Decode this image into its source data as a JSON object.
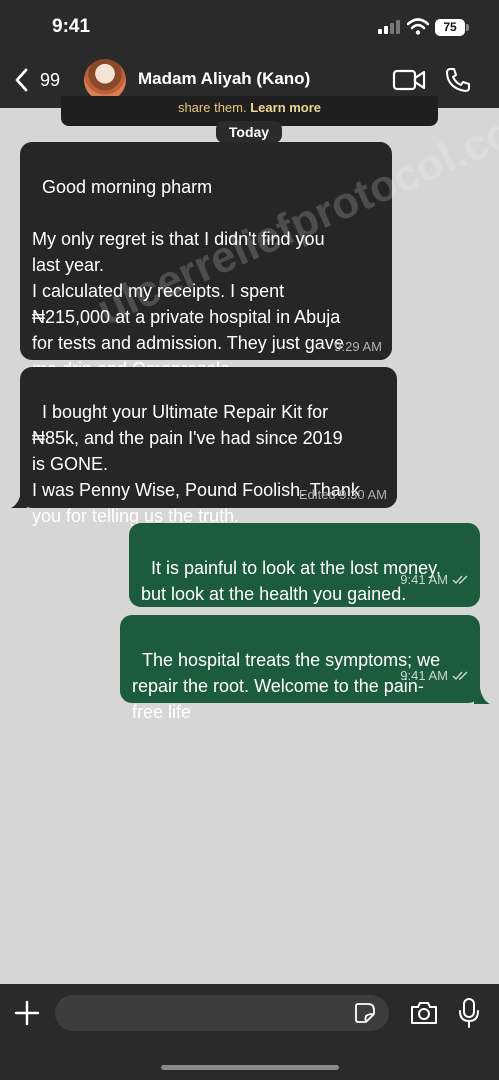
{
  "status_bar": {
    "time": "9:41",
    "battery": "75"
  },
  "header": {
    "back_count": "99",
    "contact_name": "Madam Aliyah (Kano)"
  },
  "banner": {
    "text": "share them.",
    "link": "Learn more"
  },
  "date_divider": "Today",
  "watermark": "ulcerreliefprotocol.com",
  "messages": [
    {
      "direction": "incoming",
      "text": "Good morning pharm\n\nMy only regret is that I didn't find you\nlast year.\nI calculated my receipts. I spent\n₦215,000 at a private hospital in Abuja\nfor tests and admission. They just gave\nme drip and Omeprazole.",
      "time": "9:29 AM"
    },
    {
      "direction": "incoming",
      "text": "I bought your Ultimate Repair Kit for\n₦85k, and the pain I've had since 2019\nis GONE.\nI was Penny Wise, Pound Foolish. Thank\nyou for telling us the truth.",
      "time": "Edited 9:30 AM"
    },
    {
      "direction": "outgoing",
      "text": "It is painful to look at the lost money,\nbut look at the health you gained.",
      "time": "9:41 AM"
    },
    {
      "direction": "outgoing",
      "text": "The hospital treats the symptoms; we\nrepair the root. Welcome to the pain-\nfree life",
      "time": "9:41 AM"
    }
  ],
  "composer": {
    "placeholder": ""
  },
  "colors": {
    "incoming_bubble": "#262626",
    "outgoing_bubble": "#1d5b3d",
    "background": "#d6d6d6",
    "bars": "#2a2a2a"
  },
  "icons": [
    "back-chevron-icon",
    "video-call-icon",
    "phone-icon",
    "plus-icon",
    "sticker-icon",
    "camera-icon",
    "mic-icon",
    "read-ticks-icon"
  ]
}
